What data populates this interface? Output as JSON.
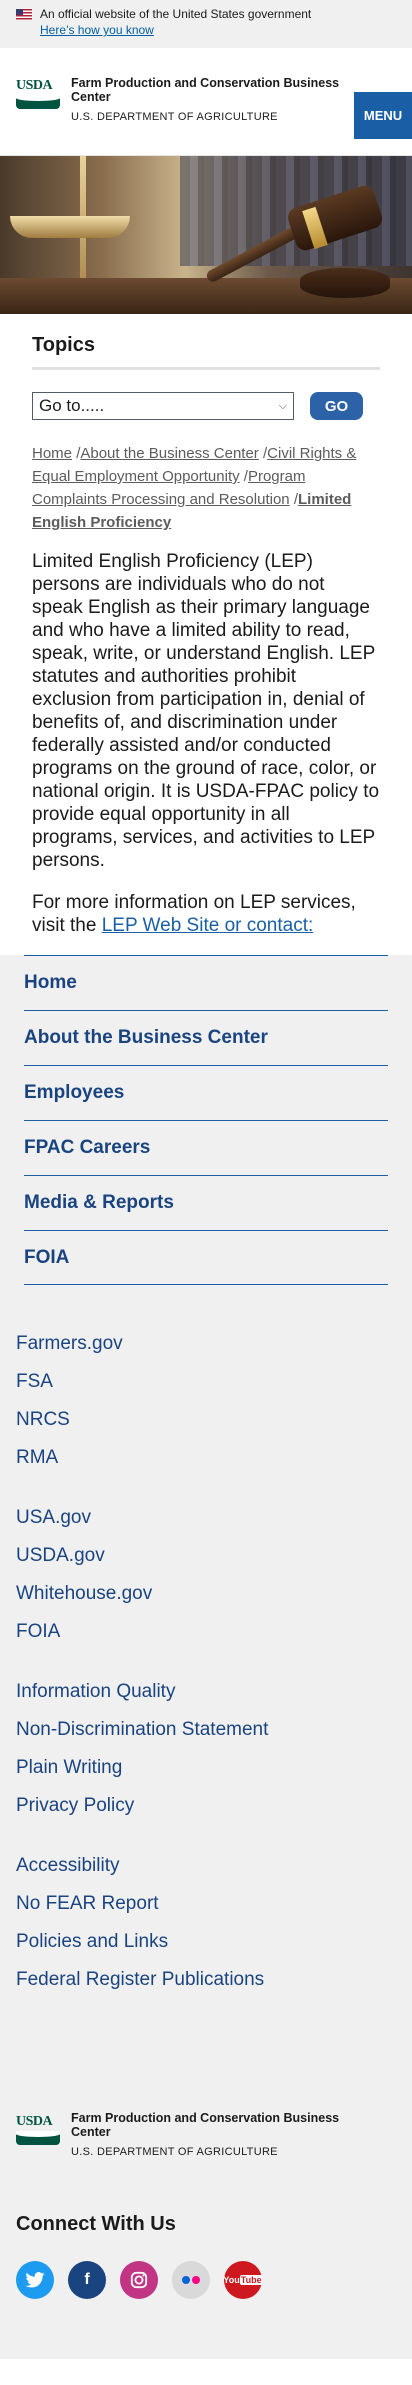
{
  "gov_banner": {
    "official": "An official website of the United States government",
    "how_link": "Here’s how you know"
  },
  "header": {
    "logo_text": "USDA",
    "agency_name": "Farm Production and Conservation Business Center",
    "department": "U.S. DEPARTMENT OF AGRICULTURE",
    "menu_label": "MENU"
  },
  "topics": {
    "heading": "Topics",
    "select_value": "Go to.....",
    "go_label": "GO"
  },
  "breadcrumb": {
    "items": [
      "Home",
      "About the Business Center",
      "Civil Rights & Equal Employment Opportunity",
      "Program Complaints Processing and Resolution"
    ],
    "current": "Limited English Proficiency"
  },
  "body": {
    "paragraph1": "Limited English Proficiency (LEP) persons are individuals who do not speak English as their primary language and who have a limited ability to read, speak, write, or understand English. LEP statutes and authorities prohibit exclusion from participation in, denial of benefits of, and discrimination under federally assisted and/or conducted programs on the ground of race, color, or national origin. It is USDA-FPAC policy to provide equal opportunity in all programs, services, and activities to LEP persons.",
    "paragraph2_prefix": "For more information on LEP services, visit the ",
    "paragraph2_link": "LEP Web Site or contact:"
  },
  "sidenav": {
    "items": [
      "Home",
      "About the Business Center",
      "Employees",
      "FPAC Careers",
      "Media & Reports",
      "FOIA"
    ]
  },
  "footer": {
    "group1": [
      "Farmers.gov",
      "FSA",
      "NRCS",
      "RMA"
    ],
    "group2": [
      "USA.gov",
      "USDA.gov",
      "Whitehouse.gov",
      "FOIA"
    ],
    "group3": [
      "Information Quality",
      "Non-Discrimination Statement",
      "Plain Writing",
      "Privacy Policy"
    ],
    "group4": [
      "Accessibility",
      "No FEAR Report",
      "Policies and Links",
      "Federal Register Publications"
    ],
    "connect_heading": "Connect With Us",
    "social_icons": [
      "twitter-icon",
      "facebook-icon",
      "instagram-icon",
      "flickr-icon",
      "youtube-icon"
    ]
  }
}
